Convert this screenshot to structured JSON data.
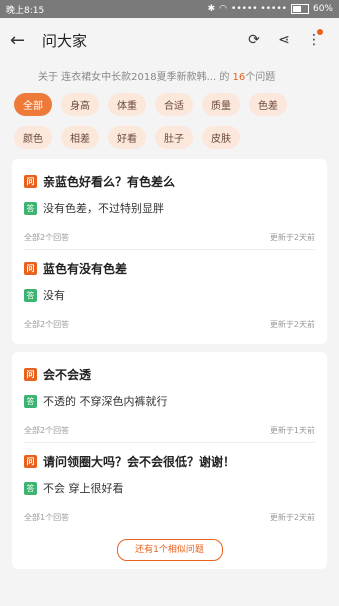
{
  "status": {
    "time": "晚上8:15",
    "signal": "••••• •••••",
    "battery": "60%",
    "battery_level": 0.6
  },
  "nav": {
    "title": "问大家"
  },
  "header": {
    "prefix": "关于 连衣裙女中长款2018夏季新款韩...",
    "mid": " 的 ",
    "count": "16",
    "suffix": "个问题"
  },
  "tags": [
    [
      "全部",
      "身高",
      "体重",
      "合适",
      "质量",
      "色差"
    ],
    [
      "颜色",
      "相差",
      "好看",
      "肚子",
      "皮肤"
    ]
  ],
  "cards": [
    {
      "items": [
        {
          "q_badge": "问",
          "question": "亲蓝色好看么？有色差么",
          "a_badge": "答",
          "answer": "没有色差，不过特别显胖",
          "count": "全部2个回答",
          "time": "更新于2天前"
        },
        {
          "q_badge": "问",
          "question": "蓝色有没有色差",
          "a_badge": "答",
          "answer": "没有",
          "count": "全部2个回答",
          "time": "更新于2天前"
        }
      ]
    },
    {
      "items": [
        {
          "q_badge": "问",
          "question": "会不会透",
          "a_badge": "答",
          "answer": "不透的 不穿深色内裤就行",
          "count": "全部2个回答",
          "time": "更新于1天前"
        },
        {
          "q_badge": "问",
          "question": "请问领圈大吗？会不会很低？谢谢！",
          "a_badge": "答",
          "answer": "不会 穿上很好看",
          "count": "全部1个回答",
          "time": "更新于2天前"
        }
      ],
      "more": "还有1个相似问题"
    }
  ]
}
